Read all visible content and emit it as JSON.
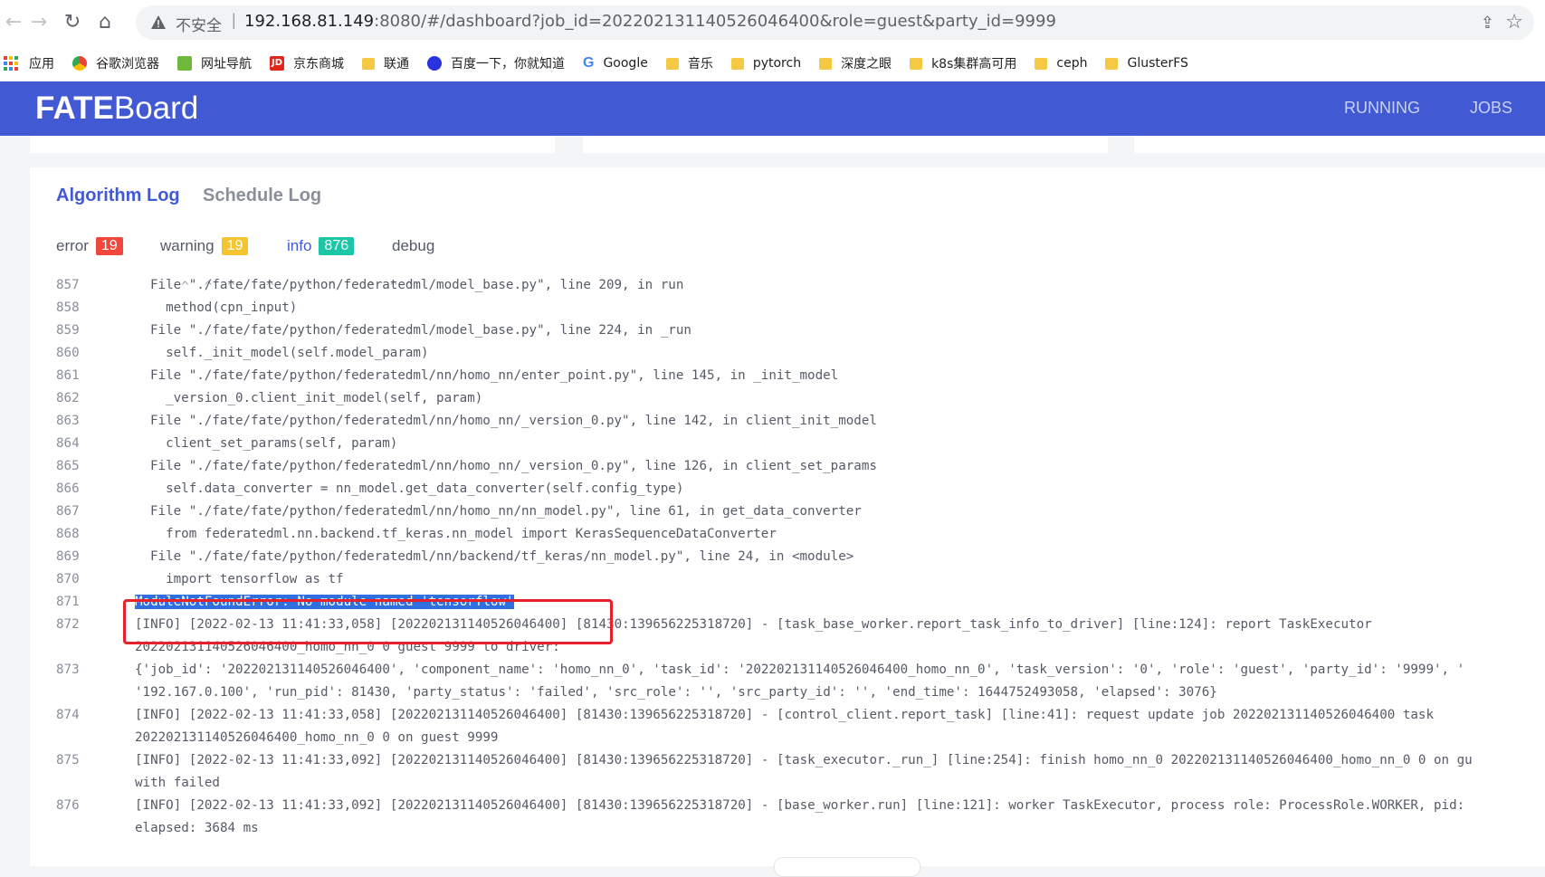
{
  "browser": {
    "insecure_label": "不安全",
    "url_host": "192.168.81.149",
    "url_rest": ":8080/#/dashboard?job_id=202202131140526046400&role=guest&party_id=9999",
    "bookmarks": [
      {
        "label": "应用",
        "icon": "apps-grid-icon"
      },
      {
        "label": "谷歌浏览器",
        "icon": "chrome-icon"
      },
      {
        "label": "网址导航",
        "icon": "nav-icon"
      },
      {
        "label": "京东商城",
        "icon": "jd-icon"
      },
      {
        "label": "联通",
        "icon": "folder-icon"
      },
      {
        "label": "百度一下，你就知道",
        "icon": "baidu-icon"
      },
      {
        "label": "Google",
        "icon": "google-icon"
      },
      {
        "label": "音乐",
        "icon": "folder-icon"
      },
      {
        "label": "pytorch",
        "icon": "folder-icon"
      },
      {
        "label": "深度之眼",
        "icon": "folder-icon"
      },
      {
        "label": "k8s集群高可用",
        "icon": "folder-icon"
      },
      {
        "label": "ceph",
        "icon": "folder-icon"
      },
      {
        "label": "GlusterFS",
        "icon": "folder-icon"
      }
    ]
  },
  "app": {
    "logo_bold": "FATE",
    "logo_rest": "Board",
    "nav": [
      "RUNNING",
      "JOBS"
    ],
    "brand_color": "#4159d3"
  },
  "log_panel": {
    "tabs": [
      "Algorithm Log",
      "Schedule Log"
    ],
    "active_tab": "Algorithm Log",
    "filters": {
      "error": {
        "label": "error",
        "count": "19",
        "color": "#f0463c"
      },
      "warning": {
        "label": "warning",
        "count": "19",
        "color": "#f5c531"
      },
      "info": {
        "label": "info",
        "count": "876",
        "color": "#1cc6a6"
      },
      "debug": {
        "label": "debug"
      }
    },
    "partial_top_line": "    ^  ^  ^    ^    ^  ^    ^  ^ ^",
    "lines": [
      {
        "n": "857",
        "text": "File \"./fate/fate/python/federatedml/model_base.py\", line 209, in run"
      },
      {
        "n": "858",
        "text": "  method(cpn_input)"
      },
      {
        "n": "859",
        "text": "File \"./fate/fate/python/federatedml/model_base.py\", line 224, in _run"
      },
      {
        "n": "860",
        "text": "  self._init_model(self.model_param)"
      },
      {
        "n": "861",
        "text": "File \"./fate/fate/python/federatedml/nn/homo_nn/enter_point.py\", line 145, in _init_model"
      },
      {
        "n": "862",
        "text": "  _version_0.client_init_model(self, param)"
      },
      {
        "n": "863",
        "text": "File \"./fate/fate/python/federatedml/nn/homo_nn/_version_0.py\", line 142, in client_init_model"
      },
      {
        "n": "864",
        "text": "  client_set_params(self, param)"
      },
      {
        "n": "865",
        "text": "File \"./fate/fate/python/federatedml/nn/homo_nn/_version_0.py\", line 126, in client_set_params"
      },
      {
        "n": "866",
        "text": "  self.data_converter = nn_model.get_data_converter(self.config_type)"
      },
      {
        "n": "867",
        "text": "File \"./fate/fate/python/federatedml/nn/homo_nn/nn_model.py\", line 61, in get_data_converter"
      },
      {
        "n": "868",
        "text": "  from federatedml.nn.backend.tf_keras.nn_model import KerasSequenceDataConverter"
      },
      {
        "n": "869",
        "text": "File \"./fate/fate/python/federatedml/nn/backend/tf_keras/nn_model.py\", line 24, in <module>"
      },
      {
        "n": "870",
        "text": "  import tensorflow as tf"
      },
      {
        "n": "871",
        "text": "ModuleNotFoundError: No module named 'tensorflow'"
      },
      {
        "n": "872",
        "text": "[INFO] [2022-02-13 11:41:33,058] [202202131140526046400] [81430:139656225318720] - [task_base_worker.report_task_info_to_driver] [line:124]: report TaskExecutor",
        "cont": "202202131140526046400_homo_nn_0 0 guest 9999 to driver:"
      },
      {
        "n": "873",
        "text": "{'job_id': '202202131140526046400', 'component_name': 'homo_nn_0', 'task_id': '202202131140526046400_homo_nn_0', 'task_version': '0', 'role': 'guest', 'party_id': '9999', '",
        "cont": "'192.167.0.100', 'run_pid': 81430, 'party_status': 'failed', 'src_role': '', 'src_party_id': '', 'end_time': 1644752493058, 'elapsed': 3076}"
      },
      {
        "n": "874",
        "text": "[INFO] [2022-02-13 11:41:33,058] [202202131140526046400] [81430:139656225318720] - [control_client.report_task] [line:41]: request update job 202202131140526046400 task",
        "cont": "202202131140526046400_homo_nn_0 0 on guest 9999"
      },
      {
        "n": "875",
        "text": "[INFO] [2022-02-13 11:41:33,092] [202202131140526046400] [81430:139656225318720] - [task_executor._run_] [line:254]: finish homo_nn_0 202202131140526046400_homo_nn_0 0 on gu",
        "cont": "with failed"
      },
      {
        "n": "876",
        "text": "[INFO] [2022-02-13 11:41:33,092] [202202131140526046400] [81430:139656225318720] - [base_worker.run] [line:121]: worker TaskExecutor, process role: ProcessRole.WORKER, pid:",
        "cont": "elapsed: 3684 ms"
      }
    ]
  }
}
